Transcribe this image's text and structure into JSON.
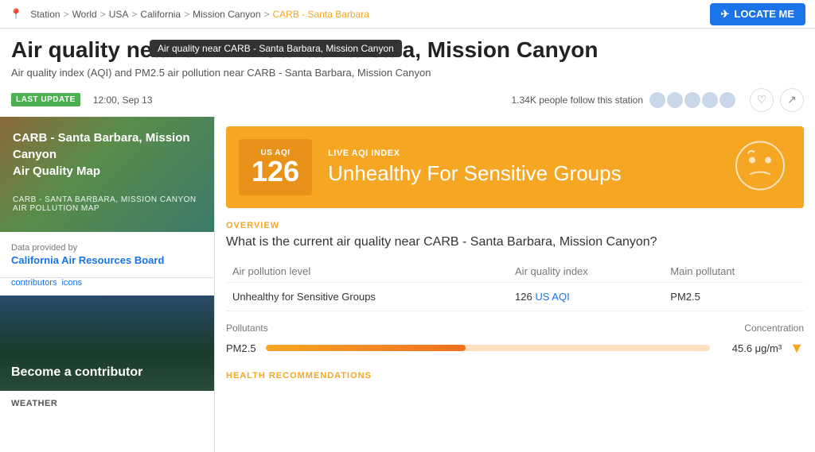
{
  "topbar": {
    "station_label": "Station",
    "breadcrumb": [
      "World",
      "USA",
      "California",
      "Mission Canyon",
      "CARB - Santa Barbara"
    ],
    "locate_button": "LOCATE ME"
  },
  "page": {
    "title": "Air quality near CARB - Santa Barbara, Mission Canyon",
    "subtitle": "Air quality index (AQI) and PM2.5 air pollution near CARB - Santa Barbara, Mission Canyon",
    "tooltip": "Air quality near CARB - Santa Barbara, Mission Canyon"
  },
  "status": {
    "last_update_label": "LAST UPDATE",
    "update_time": "12:00, Sep 13",
    "followers_text": "1.34K people follow this station"
  },
  "map_card": {
    "title": "CARB - Santa Barbara, Mission Canyon",
    "subtitle2": "Air Quality Map",
    "pollution_label": "CARB - SANTA BARBARA, MISSION CANYON AIR POLLUTION MAP"
  },
  "data_provider": {
    "label": "Data provided by",
    "name": "California Air Resources Board",
    "contributors": "contributors",
    "icons": "icons"
  },
  "contributor": {
    "text": "Become a contributor"
  },
  "weather": {
    "label": "WEATHER"
  },
  "aqi_banner": {
    "us_aqi_label": "US AQI",
    "number": "126",
    "live_label": "LIVE AQI INDEX",
    "status": "Unhealthy For Sensitive Groups"
  },
  "overview": {
    "section_label": "OVERVIEW",
    "question": "What is the current air quality near CARB - Santa Barbara, Mission Canyon?",
    "table_headers": [
      "Air pollution level",
      "Air quality index",
      "Main pollutant"
    ],
    "table_row": {
      "level": "Unhealthy for Sensitive Groups",
      "aqi_value": "126",
      "aqi_link": "US AQI",
      "pollutant": "PM2.5"
    }
  },
  "pollutants": {
    "label": "Pollutants",
    "concentration_label": "Concentration",
    "pm25": {
      "name": "PM2.5",
      "bar_percent": 45,
      "value": "45.6 μg/m³"
    }
  },
  "health_recommendations": {
    "label": "HEALTH RECOMMENDATIONS"
  }
}
